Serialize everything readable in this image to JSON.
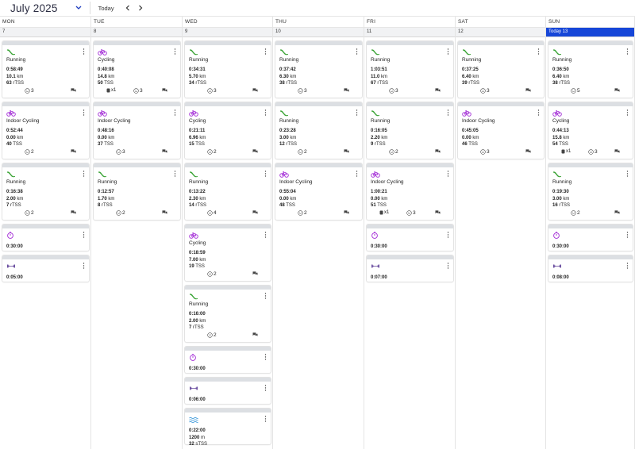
{
  "header": {
    "month_label": "July 2025",
    "today_label": "Today"
  },
  "days": [
    {
      "dow": "MON",
      "date": "7",
      "today": false
    },
    {
      "dow": "TUE",
      "date": "8",
      "today": false
    },
    {
      "dow": "WED",
      "date": "9",
      "today": false
    },
    {
      "dow": "THU",
      "date": "10",
      "today": false
    },
    {
      "dow": "FRI",
      "date": "11",
      "today": false
    },
    {
      "dow": "SAT",
      "date": "12",
      "today": false
    },
    {
      "dow": "SUN",
      "date": "Today 13",
      "today": true
    }
  ],
  "workouts": [
    {
      "day": 0,
      "type": "run",
      "title": "Running",
      "stats": [
        [
          "0:58:49",
          ""
        ],
        [
          "10.1",
          "km"
        ],
        [
          "63",
          "rTSS"
        ]
      ],
      "smile": "3"
    },
    {
      "day": 0,
      "type": "bike",
      "title": "Indoor Cycling",
      "stats": [
        [
          "0:52:44",
          ""
        ],
        [
          "0.00",
          "km"
        ],
        [
          "40",
          "TSS"
        ]
      ],
      "smile": "2"
    },
    {
      "day": 0,
      "type": "run",
      "title": "Running",
      "stats": [
        [
          "0:16:38",
          ""
        ],
        [
          "2.00",
          "km"
        ],
        [
          "7",
          "rTSS"
        ]
      ],
      "smile": "2"
    },
    {
      "day": 0,
      "type": "timer",
      "title": "",
      "stats": [
        [
          "0:30:00",
          ""
        ]
      ],
      "smile": ""
    },
    {
      "day": 0,
      "type": "strength",
      "title": "",
      "stats": [
        [
          "0:05:00",
          ""
        ]
      ],
      "smile": ""
    },
    {
      "day": 1,
      "type": "bike",
      "title": "Cycling",
      "stats": [
        [
          "0:40:08",
          ""
        ],
        [
          "14.8",
          "km"
        ],
        [
          "50",
          "TSS"
        ]
      ],
      "smile": "3",
      "shoe": "x1"
    },
    {
      "day": 1,
      "type": "bike",
      "title": "Indoor Cycling",
      "stats": [
        [
          "0:48:16",
          ""
        ],
        [
          "0.00",
          "km"
        ],
        [
          "37",
          "TSS"
        ]
      ],
      "smile": "3"
    },
    {
      "day": 1,
      "type": "run",
      "title": "Running",
      "stats": [
        [
          "0:12:57",
          ""
        ],
        [
          "1.70",
          "km"
        ],
        [
          "8",
          "rTSS"
        ]
      ],
      "smile": "2"
    },
    {
      "day": 2,
      "type": "run",
      "title": "Running",
      "stats": [
        [
          "0:34:31",
          ""
        ],
        [
          "5.70",
          "km"
        ],
        [
          "34",
          "rTSS"
        ]
      ],
      "smile": "3"
    },
    {
      "day": 2,
      "type": "bike",
      "title": "Cycling",
      "stats": [
        [
          "0:21:11",
          ""
        ],
        [
          "6.96",
          "km"
        ],
        [
          "15",
          "TSS"
        ]
      ],
      "smile": "2"
    },
    {
      "day": 2,
      "type": "run",
      "title": "Running",
      "stats": [
        [
          "0:13:22",
          ""
        ],
        [
          "2.30",
          "km"
        ],
        [
          "14",
          "rTSS"
        ]
      ],
      "smile": "4"
    },
    {
      "day": 2,
      "type": "bike",
      "title": "Cycling",
      "stats": [
        [
          "0:18:59",
          ""
        ],
        [
          "7.00",
          "km"
        ],
        [
          "19",
          "TSS"
        ]
      ],
      "smile": "2"
    },
    {
      "day": 2,
      "type": "run",
      "title": "Running",
      "stats": [
        [
          "0:16:00",
          ""
        ],
        [
          "2.00",
          "km"
        ],
        [
          "7",
          "rTSS"
        ]
      ],
      "smile": "2"
    },
    {
      "day": 2,
      "type": "timer",
      "title": "",
      "stats": [
        [
          "0:30:00",
          ""
        ]
      ],
      "smile": ""
    },
    {
      "day": 2,
      "type": "strength",
      "title": "",
      "stats": [
        [
          "0:06:00",
          ""
        ]
      ],
      "smile": ""
    },
    {
      "day": 2,
      "type": "swim",
      "title": "",
      "stats": [
        [
          "0:22:00",
          ""
        ],
        [
          "1200",
          "m"
        ],
        [
          "32",
          "sTSS"
        ]
      ],
      "smile": ""
    },
    {
      "day": 3,
      "type": "run",
      "title": "Running",
      "stats": [
        [
          "0:37:42",
          ""
        ],
        [
          "6.30",
          "km"
        ],
        [
          "38",
          "rTSS"
        ]
      ],
      "smile": "3"
    },
    {
      "day": 3,
      "type": "run",
      "title": "Running",
      "stats": [
        [
          "0:23:28",
          ""
        ],
        [
          "3.00",
          "km"
        ],
        [
          "12",
          "rTSS"
        ]
      ],
      "smile": "2"
    },
    {
      "day": 3,
      "type": "bike",
      "title": "Indoor Cycling",
      "stats": [
        [
          "0:55:04",
          ""
        ],
        [
          "0.00",
          "km"
        ],
        [
          "48",
          "TSS"
        ]
      ],
      "smile": "2"
    },
    {
      "day": 4,
      "type": "run",
      "title": "Running",
      "stats": [
        [
          "1:03:51",
          ""
        ],
        [
          "11.0",
          "km"
        ],
        [
          "67",
          "rTSS"
        ]
      ],
      "smile": "3"
    },
    {
      "day": 4,
      "type": "run",
      "title": "Running",
      "stats": [
        [
          "0:16:05",
          ""
        ],
        [
          "2.20",
          "km"
        ],
        [
          "9",
          "rTSS"
        ]
      ],
      "smile": "2"
    },
    {
      "day": 4,
      "type": "bike",
      "title": "Indoor Cycling",
      "stats": [
        [
          "1:00:21",
          ""
        ],
        [
          "0.00",
          "km"
        ],
        [
          "51",
          "TSS"
        ]
      ],
      "smile": "3",
      "shoe": "x1"
    },
    {
      "day": 4,
      "type": "timer",
      "title": "",
      "stats": [
        [
          "0:30:00",
          ""
        ]
      ],
      "smile": ""
    },
    {
      "day": 4,
      "type": "strength",
      "title": "",
      "stats": [
        [
          "0:07:00",
          ""
        ]
      ],
      "smile": ""
    },
    {
      "day": 5,
      "type": "run",
      "title": "Running",
      "stats": [
        [
          "0:37:25",
          ""
        ],
        [
          "6.40",
          "km"
        ],
        [
          "39",
          "rTSS"
        ]
      ],
      "smile": "3"
    },
    {
      "day": 5,
      "type": "bike",
      "title": "Indoor Cycling",
      "stats": [
        [
          "0:45:05",
          ""
        ],
        [
          "0.00",
          "km"
        ],
        [
          "46",
          "TSS"
        ]
      ],
      "smile": "3"
    },
    {
      "day": 6,
      "type": "run",
      "title": "Running",
      "stats": [
        [
          "0:36:50",
          ""
        ],
        [
          "6.40",
          "km"
        ],
        [
          "38",
          "rTSS"
        ]
      ],
      "smile": "5"
    },
    {
      "day": 6,
      "type": "bike",
      "title": "Cycling",
      "stats": [
        [
          "0:44:13",
          ""
        ],
        [
          "15.8",
          "km"
        ],
        [
          "54",
          "TSS"
        ]
      ],
      "smile": "3",
      "shoe": "x1"
    },
    {
      "day": 6,
      "type": "run",
      "title": "Running",
      "stats": [
        [
          "0:19:30",
          ""
        ],
        [
          "3.00",
          "km"
        ],
        [
          "16",
          "rTSS"
        ]
      ],
      "smile": "2"
    },
    {
      "day": 6,
      "type": "timer",
      "title": "",
      "stats": [
        [
          "0:30:00",
          ""
        ]
      ],
      "smile": ""
    },
    {
      "day": 6,
      "type": "strength",
      "title": "",
      "stats": [
        [
          "0:08:00",
          ""
        ]
      ],
      "smile": ""
    }
  ],
  "colors": {
    "run": "#3aa335",
    "bike": "#a22bd6",
    "timer": "#a22bd6",
    "strength": "#6b4fa0",
    "swim": "#2a8fd6",
    "today_bg": "#1646d8"
  }
}
